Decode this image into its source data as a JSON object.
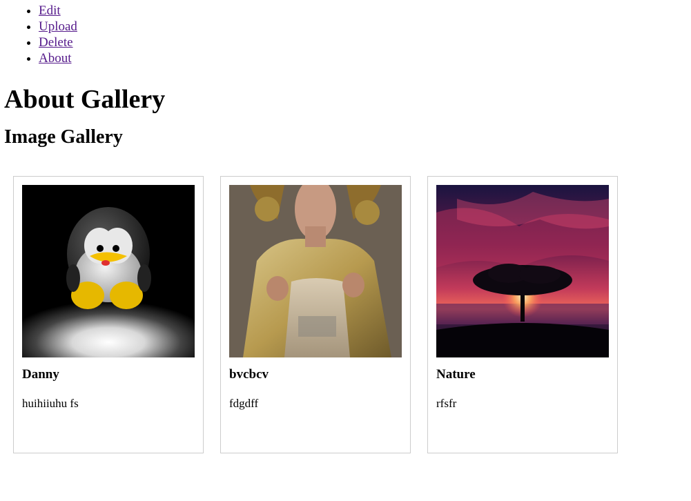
{
  "nav": {
    "items": [
      {
        "label": "Edit"
      },
      {
        "label": "Upload"
      },
      {
        "label": "Delete"
      },
      {
        "label": "About"
      }
    ]
  },
  "page": {
    "title": "About Gallery",
    "section_title": "Image Gallery"
  },
  "gallery": {
    "cards": [
      {
        "title": "Danny",
        "description": "huihiiuhu fs",
        "image": "penguin-plush-photo"
      },
      {
        "title": "bvcbcv",
        "description": "fdgdff",
        "image": "statue-photo"
      },
      {
        "title": "Nature",
        "description": "rfsfr",
        "image": "sunset-tree-photo"
      }
    ]
  }
}
